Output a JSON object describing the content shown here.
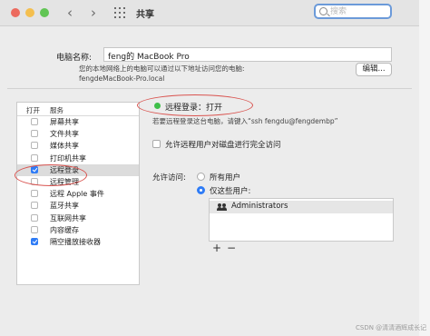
{
  "window": {
    "title": "共享"
  },
  "search": {
    "placeholder": "搜索"
  },
  "computer_name": {
    "label": "电脑名称:",
    "value": "feng的 MacBook Pro",
    "note": "您的本地网络上的电脑可以通过以下地址访问您的电脑:",
    "address": "fengdeMacBook-Pro.local",
    "edit_button": "编辑..."
  },
  "services": {
    "header_on": "打开",
    "header_service": "服务",
    "items": [
      {
        "label": "屏幕共享",
        "checked": false,
        "selected": false
      },
      {
        "label": "文件共享",
        "checked": false,
        "selected": false
      },
      {
        "label": "媒体共享",
        "checked": false,
        "selected": false
      },
      {
        "label": "打印机共享",
        "checked": false,
        "selected": false
      },
      {
        "label": "远程登录",
        "checked": true,
        "selected": true
      },
      {
        "label": "远程管理",
        "checked": false,
        "selected": false
      },
      {
        "label": "远程 Apple 事件",
        "checked": false,
        "selected": false
      },
      {
        "label": "蓝牙共享",
        "checked": false,
        "selected": false
      },
      {
        "label": "互联网共享",
        "checked": false,
        "selected": false
      },
      {
        "label": "内容缓存",
        "checked": false,
        "selected": false
      },
      {
        "label": "隔空播放接收器",
        "checked": true,
        "selected": false
      }
    ]
  },
  "detail": {
    "status": "远程登录：打开",
    "status_color": "#3fbf4a",
    "hint": "若要远程登录这台电脑，请键入“ssh fengdu@fengdembp”",
    "full_disk_option": "允许远程用户对磁盘进行完全访问",
    "allow_label": "允许访问:",
    "radio_all": "所有用户",
    "radio_only": "仅这些用户:",
    "users": [
      "Administrators"
    ],
    "add_button": "+",
    "remove_button": "−"
  },
  "watermark": "CSDN @清清酒辉成长记",
  "colors": {
    "accent": "#2f7cf6",
    "annotation": "#d9534f"
  }
}
